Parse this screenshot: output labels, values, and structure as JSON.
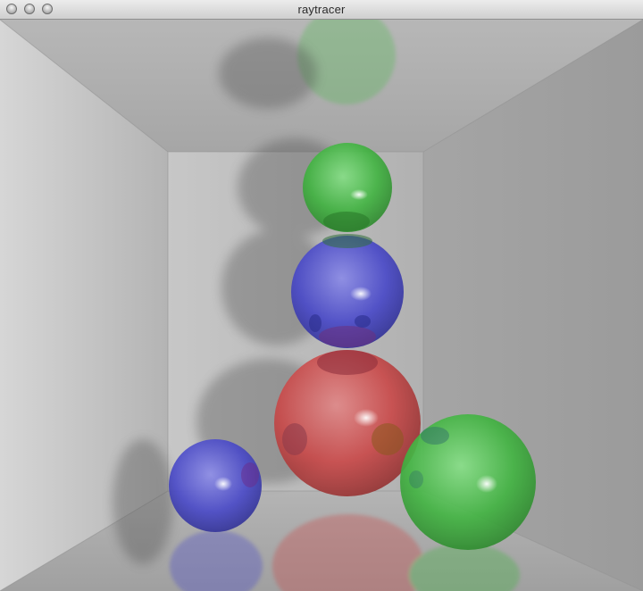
{
  "window": {
    "title": "raytracer",
    "buttons": [
      {
        "name": "close-button"
      },
      {
        "name": "minimize-button"
      },
      {
        "name": "zoom-button"
      }
    ]
  },
  "scene": {
    "colors": {
      "red_sphere": "#c94a4a",
      "green_sphere": "#43b443",
      "blue_sphere": "#4b4bc8",
      "walls": "#a9a9a9"
    }
  }
}
